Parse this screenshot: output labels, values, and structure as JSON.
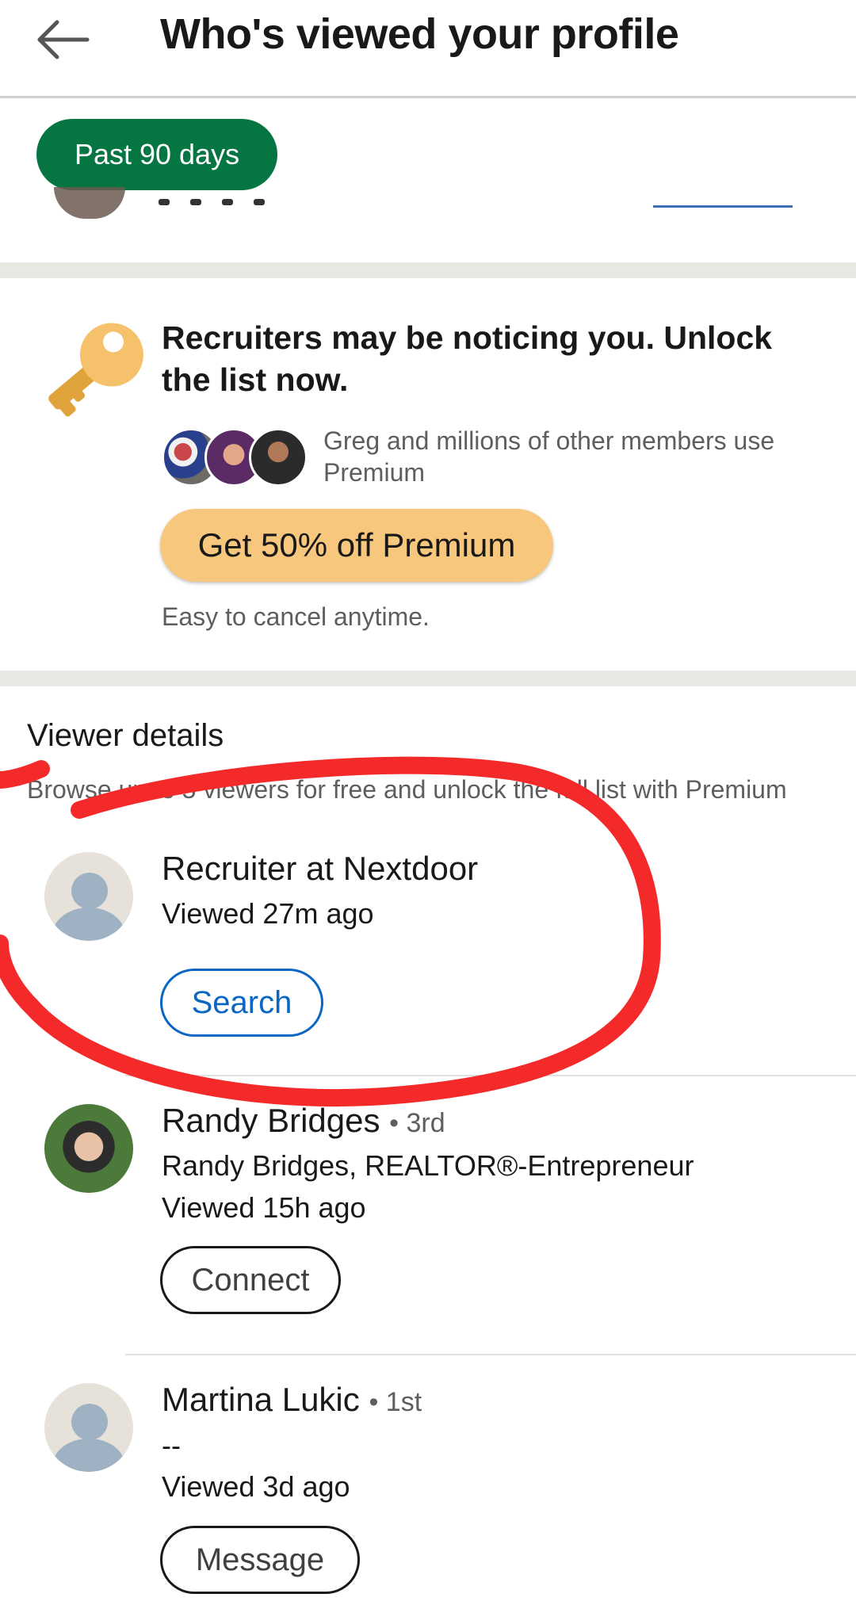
{
  "header": {
    "title": "Who's viewed your profile",
    "back_icon": "arrow-left-icon"
  },
  "filter": {
    "label": "Past 90 days",
    "color": "#057642"
  },
  "premium_card": {
    "icon": "key-icon",
    "headline": "Recruiters may be noticing you. Unlock the list now.",
    "members_text": "Greg and millions of other members use Premium",
    "cta_label": "Get 50% off Premium",
    "cta_color": "#f8c77e",
    "note": "Easy to cancel anytime."
  },
  "viewer_details": {
    "title": "Viewer details",
    "subtitle": "Browse up to 5 viewers for free and unlock the full list with Premium"
  },
  "viewers": [
    {
      "name": "Recruiter at Nextdoor",
      "viewed": "Viewed 27m ago",
      "action": "Search"
    },
    {
      "name": "Randy Bridges",
      "degree": "• 3rd",
      "headline": "Randy Bridges, REALTOR®-Entrepreneur",
      "viewed": "Viewed 15h ago",
      "action": "Connect"
    },
    {
      "name": "Martina Lukic",
      "degree": "• 1st",
      "headline": "--",
      "viewed": "Viewed 3d ago",
      "action": "Message"
    }
  ],
  "annotation": {
    "color": "#f42a2a"
  }
}
